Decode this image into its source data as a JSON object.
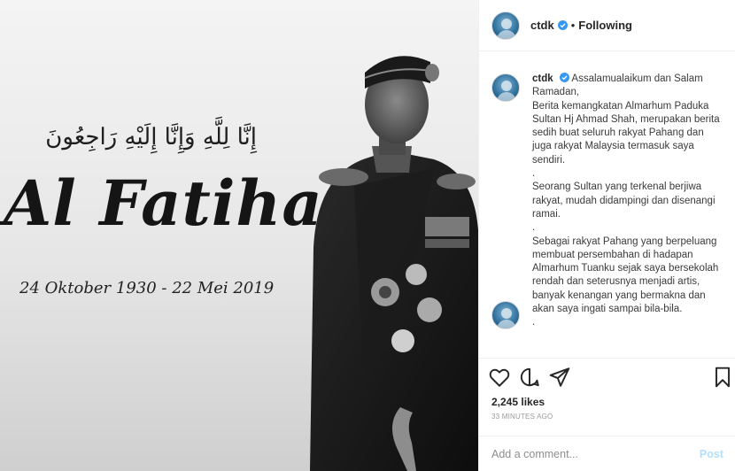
{
  "post_image": {
    "arabic_text": "إِنَّا لِلَّهِ وَإِنَّا إِلَيْهِ رَاجِعُونَ",
    "headline": "Al Fatihah",
    "dates": "24 Oktober 1930 - 22 Mei 2019"
  },
  "header": {
    "username": "ctdk",
    "separator": "•",
    "follow_state": "Following"
  },
  "caption": {
    "username": "ctdk",
    "paragraphs": [
      "Assalamualaikum dan Salam Ramadan,",
      "Berita kemangkatan Almarhum Paduka Sultan Hj Ahmad Shah, merupakan berita sedih buat seluruh rakyat Pahang dan juga rakyat Malaysia termasuk saya sendiri.",
      ".",
      "Seorang Sultan yang terkenal berjiwa rakyat, mudah didampingi dan disenangi ramai.",
      ".",
      "Sebagai rakyat Pahang yang berpeluang membuat persembahan di hadapan Almarhum Tuanku sejak saya bersekolah rendah dan seterusnya menjadi artis, banyak kenangan yang bermakna dan akan saya ingati sampai bila-bila.",
      "."
    ]
  },
  "actions": {
    "likes": "2,245 likes",
    "timestamp": "33 MINUTES AGO"
  },
  "comment_box": {
    "placeholder": "Add a comment...",
    "post_label": "Post"
  },
  "icons": {
    "verified": "verified-badge-icon",
    "like": "heart-icon",
    "comment": "comment-icon",
    "share": "share-icon",
    "save": "bookmark-icon"
  },
  "colors": {
    "verified_blue": "#3897f0",
    "post_disabled": "#b2dffc",
    "border": "#efefef"
  }
}
